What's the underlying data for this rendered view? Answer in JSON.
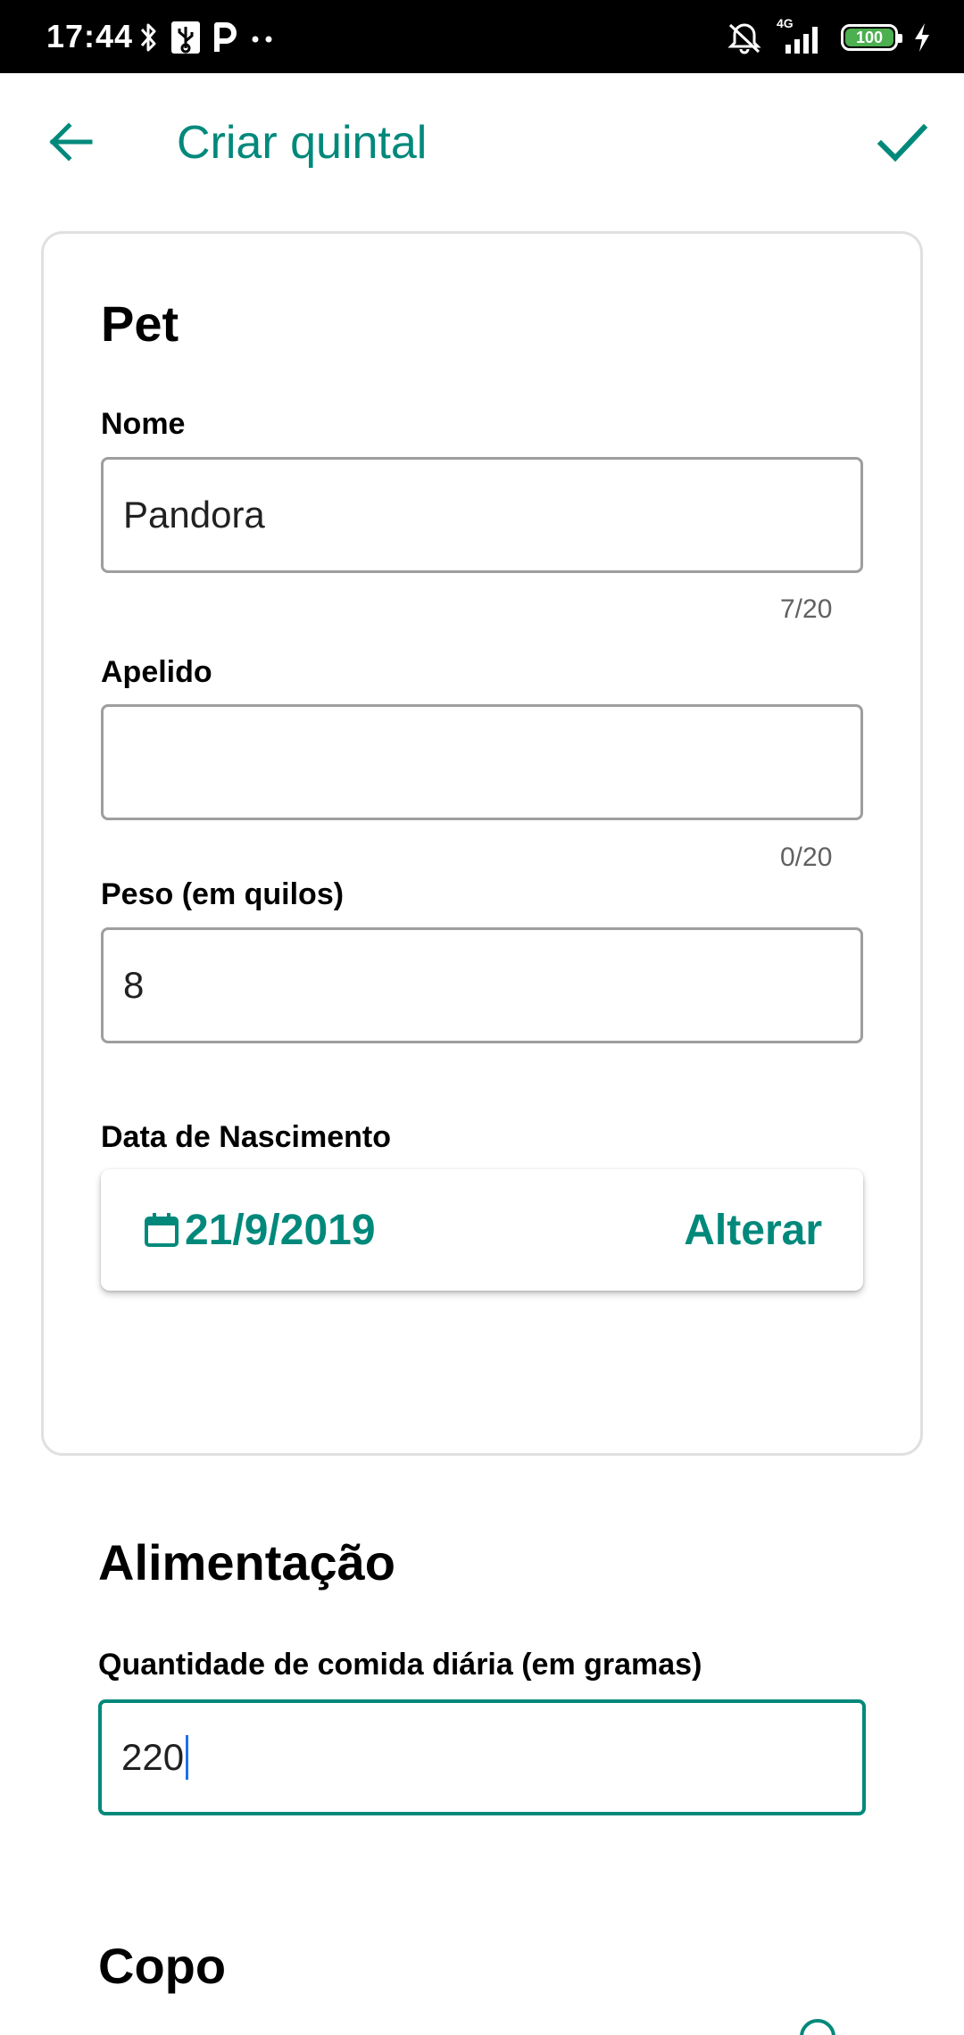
{
  "status_bar": {
    "time": "17:44",
    "network_label": "4G",
    "battery_level": "100",
    "battery_percent": 100,
    "icons": [
      "bluetooth-icon",
      "usb-icon",
      "parking-icon",
      "more-dots-icon",
      "alarm-off-icon",
      "signal-icon",
      "battery-icon",
      "charging-icon"
    ]
  },
  "app_bar": {
    "title": "Criar quintal",
    "back_icon": "arrow-back-icon",
    "confirm_icon": "check-icon"
  },
  "pet_section": {
    "title": "Pet",
    "name": {
      "label": "Nome",
      "value": "Pandora",
      "counter": "7/20"
    },
    "nickname": {
      "label": "Apelido",
      "value": "",
      "counter": "0/20"
    },
    "weight": {
      "label": "Peso (em quilos)",
      "value": "8"
    },
    "birthdate": {
      "label": "Data de Nascimento",
      "value": "21/9/2019",
      "change_label": "Alterar",
      "icon": "calendar-icon"
    }
  },
  "feeding_section": {
    "title": "Alimentação",
    "daily_food": {
      "label": "Quantidade de comida diária (em gramas)",
      "value": "220"
    }
  },
  "cup_section": {
    "title": "Copo"
  },
  "colors": {
    "accent": "#00897b",
    "status_bar": "#000000",
    "battery": "#4caf50",
    "caret": "#1e6fe8"
  }
}
